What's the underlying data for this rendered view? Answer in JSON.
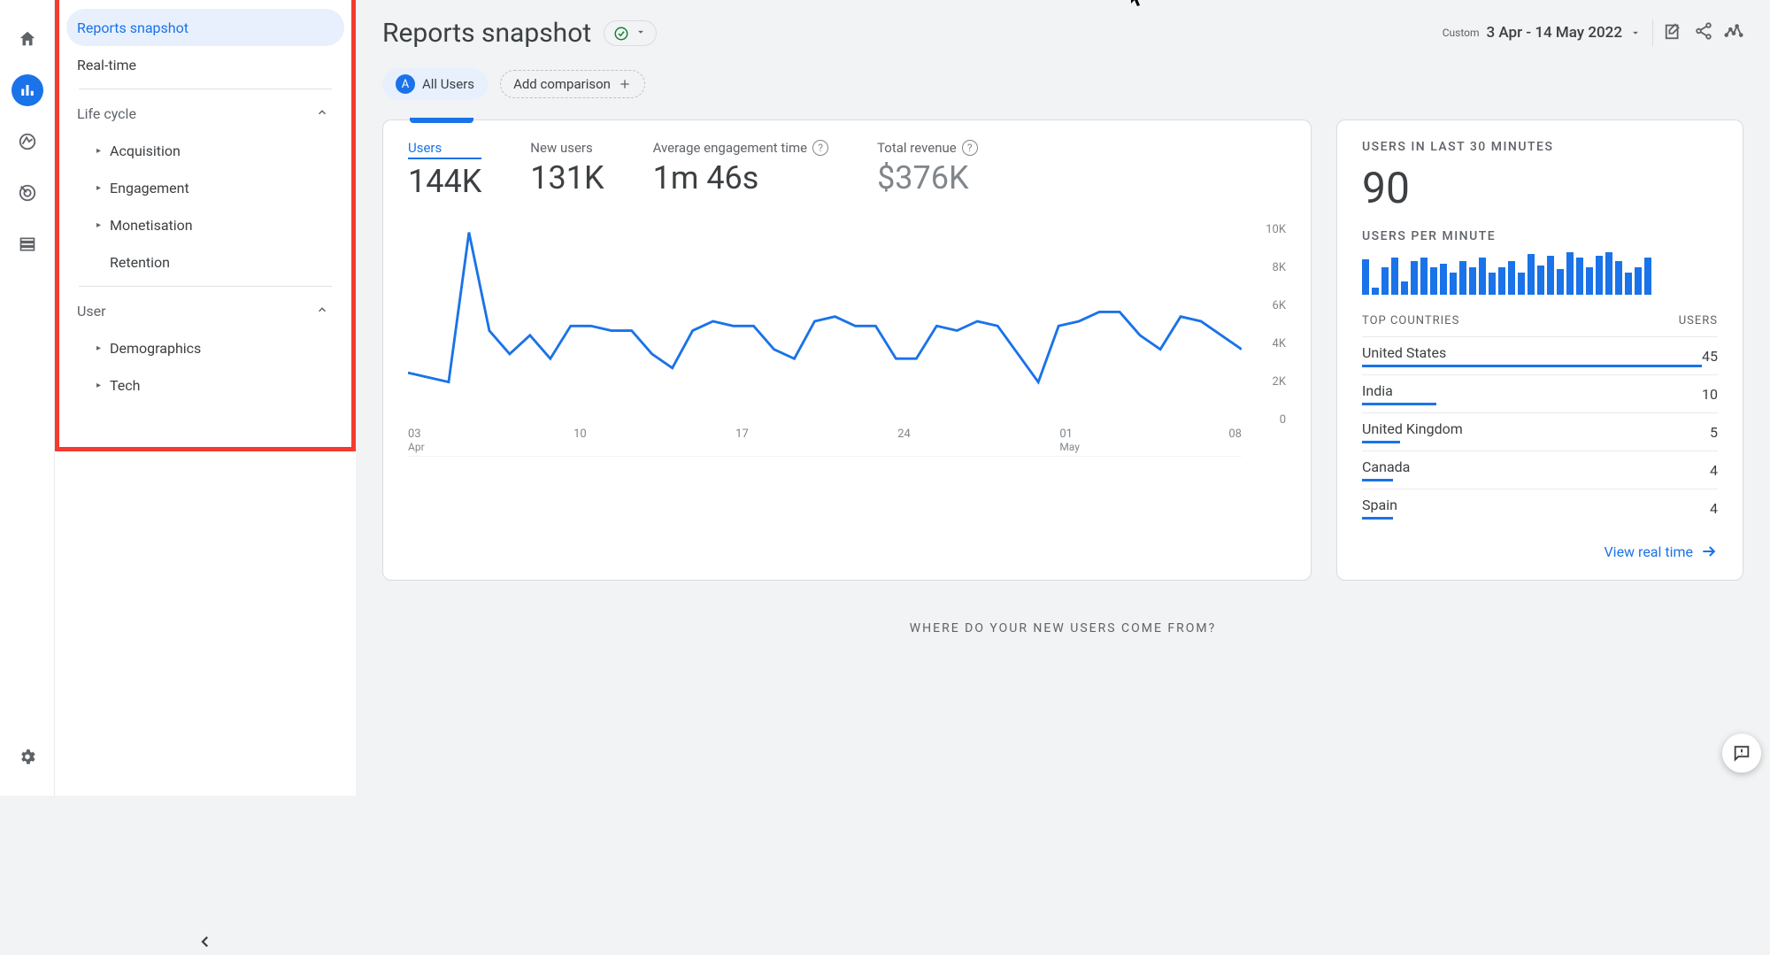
{
  "rail": {
    "icons": [
      "home",
      "reports",
      "explore",
      "advertising",
      "configure"
    ]
  },
  "sidebar": {
    "reports_snapshot": "Reports snapshot",
    "realtime": "Real-time",
    "section_lifecycle": "Life cycle",
    "items_lifecycle": [
      "Acquisition",
      "Engagement",
      "Monetisation",
      "Retention"
    ],
    "section_user": "User",
    "items_user": [
      "Demographics",
      "Tech"
    ]
  },
  "header": {
    "title": "Reports snapshot",
    "date_label": "Custom",
    "date_range": "3 Apr - 14 May 2022"
  },
  "chips": {
    "all_users": "All Users",
    "add_comparison": "Add comparison"
  },
  "metrics": [
    {
      "label": "Users",
      "value": "144K"
    },
    {
      "label": "New users",
      "value": "131K"
    },
    {
      "label": "Average engagement time",
      "value": "1m 46s",
      "help": true
    },
    {
      "label": "Total revenue",
      "value": "$376K",
      "help": true
    }
  ],
  "chart_data": {
    "type": "line",
    "x_ticks": [
      "03",
      "10",
      "17",
      "24",
      "01",
      "08"
    ],
    "x_sub": [
      "Apr",
      "",
      "",
      "",
      "May",
      ""
    ],
    "y_ticks": [
      "10K",
      "8K",
      "6K",
      "4K",
      "2K",
      "0"
    ],
    "ylim": [
      0,
      10000
    ],
    "series": [
      {
        "name": "Users",
        "x": [
          0,
          1,
          2,
          3,
          4,
          5,
          6,
          7,
          8,
          9,
          10,
          11,
          12,
          13,
          14,
          15,
          16,
          17,
          18,
          19,
          20,
          21,
          22,
          23,
          24,
          25,
          26,
          27,
          28,
          29,
          30,
          31,
          32,
          33,
          34,
          35,
          36,
          37,
          38,
          39,
          40,
          41
        ],
        "y": [
          3600,
          3400,
          3200,
          9600,
          5400,
          4400,
          5200,
          4200,
          5600,
          5600,
          5400,
          5400,
          4400,
          3800,
          5400,
          5800,
          5600,
          5600,
          4600,
          4200,
          5800,
          6000,
          5600,
          5600,
          4200,
          4200,
          5600,
          5400,
          5800,
          5600,
          4400,
          3200,
          5600,
          5800,
          6200,
          6200,
          5200,
          4600,
          6000,
          5800,
          5200,
          4600
        ]
      }
    ]
  },
  "realtime_card": {
    "title": "USERS IN LAST 30 MINUTES",
    "value": "90",
    "spark_title": "USERS PER MINUTE",
    "spark": [
      38,
      8,
      30,
      40,
      14,
      36,
      40,
      30,
      34,
      24,
      36,
      30,
      40,
      24,
      30,
      36,
      24,
      44,
      32,
      42,
      28,
      46,
      40,
      30,
      42,
      46,
      36,
      24,
      30,
      40
    ],
    "tc_title_left": "TOP COUNTRIES",
    "tc_title_right": "USERS",
    "countries": [
      {
        "name": "United States",
        "users": 45,
        "bar": 100
      },
      {
        "name": "India",
        "users": 10,
        "bar": 22
      },
      {
        "name": "United Kingdom",
        "users": 5,
        "bar": 11
      },
      {
        "name": "Canada",
        "users": 4,
        "bar": 9
      },
      {
        "name": "Spain",
        "users": 4,
        "bar": 9
      }
    ],
    "view_link": "View real time"
  },
  "bottom_heading": "WHERE DO YOUR NEW USERS COME FROM?"
}
